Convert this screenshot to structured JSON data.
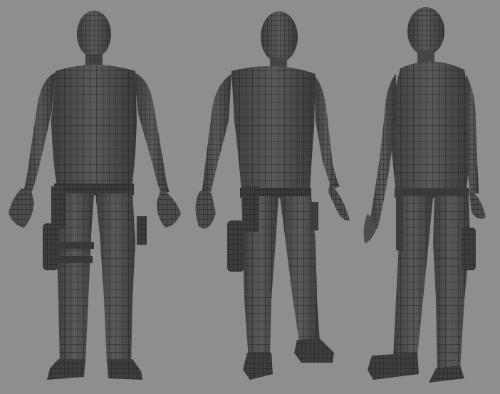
{
  "scene": {
    "background_color": "#8e8e8e",
    "mesh_fill_color": "#4a4a4a",
    "mesh_shade_color": "#3a3a3a",
    "wireframe_color": "#161616",
    "highlight_color": "#6a6a6a"
  },
  "views": [
    {
      "id": "front",
      "description_icon": "character-front-view"
    },
    {
      "id": "three-quarter",
      "description_icon": "character-three-quarter-view"
    },
    {
      "id": "back",
      "description_icon": "character-back-view"
    }
  ]
}
